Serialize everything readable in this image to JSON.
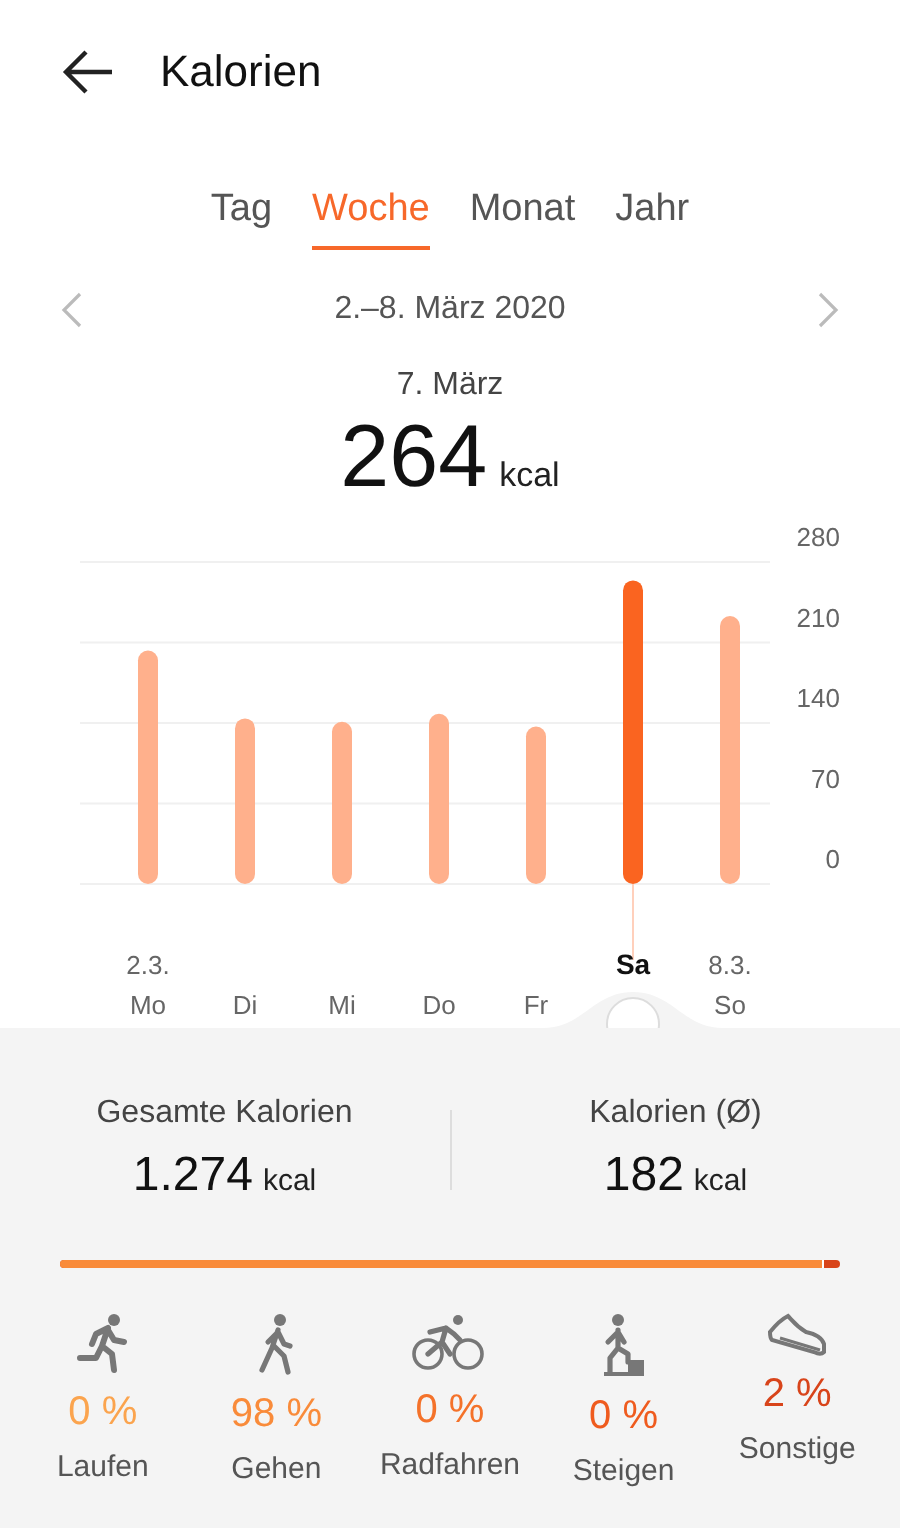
{
  "header": {
    "title": "Kalorien"
  },
  "tabs": [
    {
      "label": "Tag",
      "selected": false
    },
    {
      "label": "Woche",
      "selected": true
    },
    {
      "label": "Monat",
      "selected": false
    },
    {
      "label": "Jahr",
      "selected": false
    }
  ],
  "date_nav": {
    "range": "2.–8. März 2020"
  },
  "summary": {
    "date": "7. März",
    "value": "264",
    "unit": "kcal"
  },
  "chart_data": {
    "type": "bar",
    "categories": [
      "Mo",
      "Di",
      "Mi",
      "Do",
      "Fr",
      "Sa",
      "So"
    ],
    "values": [
      203,
      144,
      141,
      148,
      137,
      264,
      233
    ],
    "ylim": [
      0,
      280
    ],
    "yticks": [
      0,
      70,
      140,
      210,
      280
    ],
    "grid": true
  },
  "days": [
    {
      "date": "2.3.",
      "selected": false
    },
    {
      "selected": false
    },
    {
      "selected": false
    },
    {
      "selected": false
    },
    {
      "selected": false
    },
    {
      "selected": true
    },
    {
      "date": "8.3.",
      "selected": false
    }
  ],
  "stats": [
    {
      "label": "Gesamte Kalorien",
      "value": "1.274",
      "unit": "kcal"
    },
    {
      "label": "Kalorien (Ø)",
      "value": "182",
      "unit": "kcal"
    }
  ],
  "share_bar": {
    "level": 0.98
  },
  "activities": [
    {
      "kind": "run",
      "percent": "0 %",
      "label": "Laufen",
      "color": "#fba44e"
    },
    {
      "kind": "walk",
      "percent": "98 %",
      "label": "Gehen",
      "color": "#f98b3a"
    },
    {
      "kind": "bike",
      "percent": "0 %",
      "label": "Radfahren",
      "color": "#f4722a"
    },
    {
      "kind": "climb",
      "percent": "0 %",
      "label": "Steigen",
      "color": "#ef5b1e"
    },
    {
      "kind": "other",
      "percent": "2 %",
      "label": "Sonstige",
      "color": "#d8441a"
    }
  ]
}
